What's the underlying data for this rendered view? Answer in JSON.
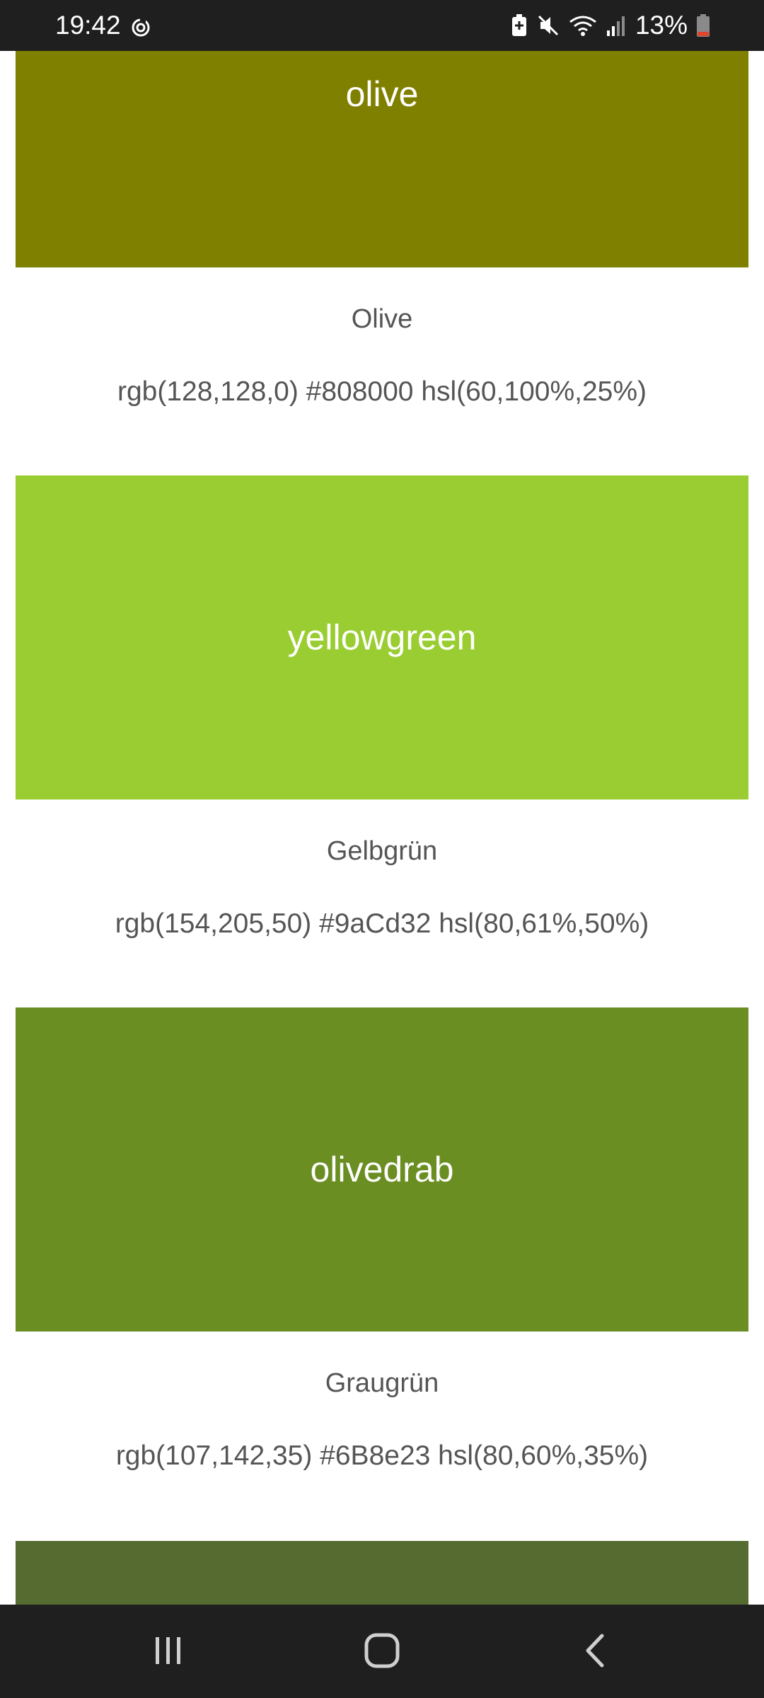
{
  "status_bar": {
    "time": "19:42",
    "battery_percent": "13%",
    "icons": [
      "sync-icon",
      "battery-saver-icon",
      "mute-icon",
      "wifi-icon",
      "signal-icon",
      "battery-icon"
    ]
  },
  "colors": [
    {
      "label": "olive",
      "name_de": "Olive",
      "codes": "rgb(128,128,0) #808000 hsl(60,100%,25%)",
      "hex": "#808000"
    },
    {
      "label": "yellowgreen",
      "name_de": "Gelbgrün",
      "codes": "rgb(154,205,50) #9aCd32 hsl(80,61%,50%)",
      "hex": "#9acd32"
    },
    {
      "label": "olivedrab",
      "name_de": "Graugrün",
      "codes": "rgb(107,142,35) #6B8e23 hsl(80,60%,35%)",
      "hex": "#6b8e23"
    },
    {
      "hex": "#556b2f"
    }
  ],
  "nav_bar": {
    "buttons": [
      "recent-apps-icon",
      "home-icon",
      "back-icon"
    ]
  }
}
